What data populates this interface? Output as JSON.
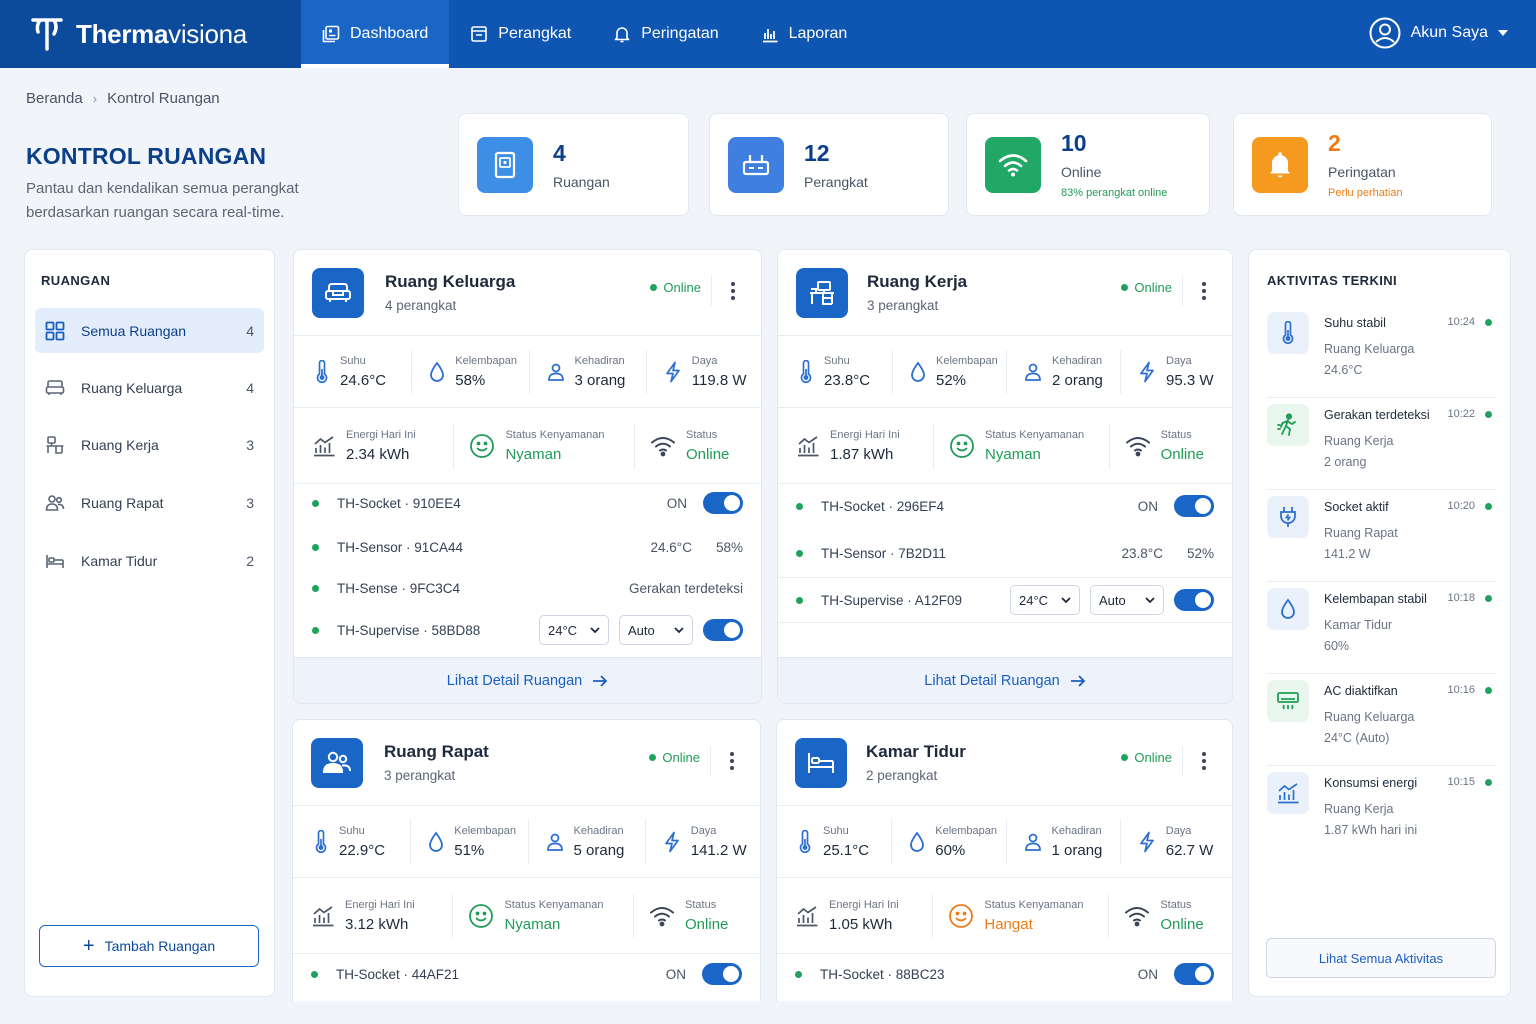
{
  "app": {
    "brand_light": "Therma",
    "brand_bold": "visiona",
    "account": "Akun Saya"
  },
  "nav": [
    {
      "label": "Dashboard",
      "icon": "dashboard-icon"
    },
    {
      "label": "Perangkat",
      "icon": "device-icon"
    },
    {
      "label": "Peringatan",
      "icon": "bell-icon"
    },
    {
      "label": "Laporan",
      "icon": "report-icon"
    }
  ],
  "breadcrumb": {
    "home": "Beranda",
    "current": "Kontrol Ruangan"
  },
  "page": {
    "title": "KONTROL RUANGAN",
    "description": "Pantau dan kendalikan semua perangkat berdasarkan ruangan secara real-time."
  },
  "stats": [
    {
      "value": "4",
      "label": "Ruangan",
      "sub": "",
      "icon": "door-icon",
      "color": "#3d8fe6"
    },
    {
      "value": "12",
      "label": "Perangkat",
      "sub": "",
      "icon": "router-icon",
      "color": "#3f7fe0"
    },
    {
      "value": "10",
      "label": "Online",
      "sub": "83% perangkat online",
      "icon": "wifi-icon",
      "color": "#22a866"
    },
    {
      "value": "2",
      "label": "Peringatan",
      "sub": "Perlu perhatian",
      "icon": "bell-icon",
      "color": "#f59a1e"
    }
  ],
  "sidebar": {
    "title": "RUANGAN",
    "add_label": "Tambah Ruangan",
    "items": [
      {
        "label": "Semua Ruangan",
        "count": "4",
        "icon": "grid-icon"
      },
      {
        "label": "Ruang Keluarga",
        "count": "4",
        "icon": "sofa-icon"
      },
      {
        "label": "Ruang Kerja",
        "count": "3",
        "icon": "desk-icon"
      },
      {
        "label": "Ruang Rapat",
        "count": "3",
        "icon": "people-icon"
      },
      {
        "label": "Kamar Tidur",
        "count": "2",
        "icon": "bed-icon"
      }
    ]
  },
  "labels": {
    "suhu": "Suhu",
    "kelembapan": "Kelembapan",
    "kehadiran": "Kehadiran",
    "daya": "Daya",
    "energi": "Energi Hari Ini",
    "kenyamanan": "Status Kenyamanan",
    "status": "Status",
    "detail": "Lihat Detail Ruangan",
    "on": "ON"
  },
  "rooms": [
    {
      "name": "Ruang Keluarga",
      "devices": "4 perangkat",
      "online": "Online",
      "suhu": "24.6°C",
      "kelembapan": "58%",
      "kehadiran": "3 orang",
      "daya": "119.8 W",
      "energi": "2.34 kWh",
      "kenyamanan": "Nyaman",
      "status": "Online",
      "list": [
        {
          "name": "TH-Socket · 910EE4"
        },
        {
          "name": "TH-Sensor · 91CA44",
          "a": "24.6°C",
          "b": "58%"
        },
        {
          "name": "TH-Sense · 9FC3C4",
          "a": "Gerakan terdeteksi"
        },
        {
          "name": "TH-Supervise · 58BD88",
          "temp": "24°C",
          "mode": "Auto"
        }
      ]
    },
    {
      "name": "Ruang Kerja",
      "devices": "3 perangkat",
      "online": "Online",
      "suhu": "23.8°C",
      "kelembapan": "52%",
      "kehadiran": "2 orang",
      "daya": "95.3 W",
      "energi": "1.87 kWh",
      "kenyamanan": "Nyaman",
      "status": "Online",
      "list": [
        {
          "name": "TH-Socket · 296EF4"
        },
        {
          "name": "TH-Sensor · 7B2D11",
          "a": "23.8°C",
          "b": "52%"
        },
        {
          "name": "TH-Supervise · A12F09",
          "temp": "24°C",
          "mode": "Auto"
        }
      ]
    },
    {
      "name": "Ruang Rapat",
      "devices": "3 perangkat",
      "online": "Online",
      "suhu": "22.9°C",
      "kelembapan": "51%",
      "kehadiran": "5 orang",
      "daya": "141.2 W",
      "energi": "3.12 kWh",
      "kenyamanan": "Nyaman",
      "status": "Online",
      "list": [
        {
          "name": "TH-Socket · 44AF21"
        }
      ]
    },
    {
      "name": "Kamar Tidur",
      "devices": "2 perangkat",
      "online": "Online",
      "suhu": "25.1°C",
      "kelembapan": "60%",
      "kehadiran": "1 orang",
      "daya": "62.7 W",
      "energi": "1.05 kWh",
      "kenyamanan": "Hangat",
      "status": "Online",
      "list": [
        {
          "name": "TH-Socket · 88BC23"
        }
      ]
    }
  ],
  "activity": {
    "title": "AKTIVITAS TERKINI",
    "all": "Lihat Semua Aktivitas",
    "items": [
      {
        "title": "Suhu stabil",
        "time": "10:24",
        "room": "Ruang Keluarga",
        "detail": "24.6°C",
        "icon": "thermometer-icon"
      },
      {
        "title": "Gerakan terdeteksi",
        "time": "10:22",
        "room": "Ruang Kerja",
        "detail": "2 orang",
        "icon": "motion-icon"
      },
      {
        "title": "Socket aktif",
        "time": "10:20",
        "room": "Ruang Rapat",
        "detail": "141.2 W",
        "icon": "plug-icon"
      },
      {
        "title": "Kelembapan stabil",
        "time": "10:18",
        "room": "Kamar Tidur",
        "detail": "60%",
        "icon": "droplet-icon"
      },
      {
        "title": "AC diaktifkan",
        "time": "10:16",
        "room": "Ruang Keluarga",
        "detail": "24°C (Auto)",
        "icon": "ac-icon"
      },
      {
        "title": "Konsumsi energi",
        "time": "10:15",
        "room": "Ruang Kerja",
        "detail": "1.87 kWh hari ini",
        "icon": "energy-icon"
      }
    ]
  },
  "colors": {
    "primary": "#0f56b3",
    "brand_dark": "#0c4a9c",
    "online": "#1f9d57",
    "warm": "#f07b16"
  }
}
